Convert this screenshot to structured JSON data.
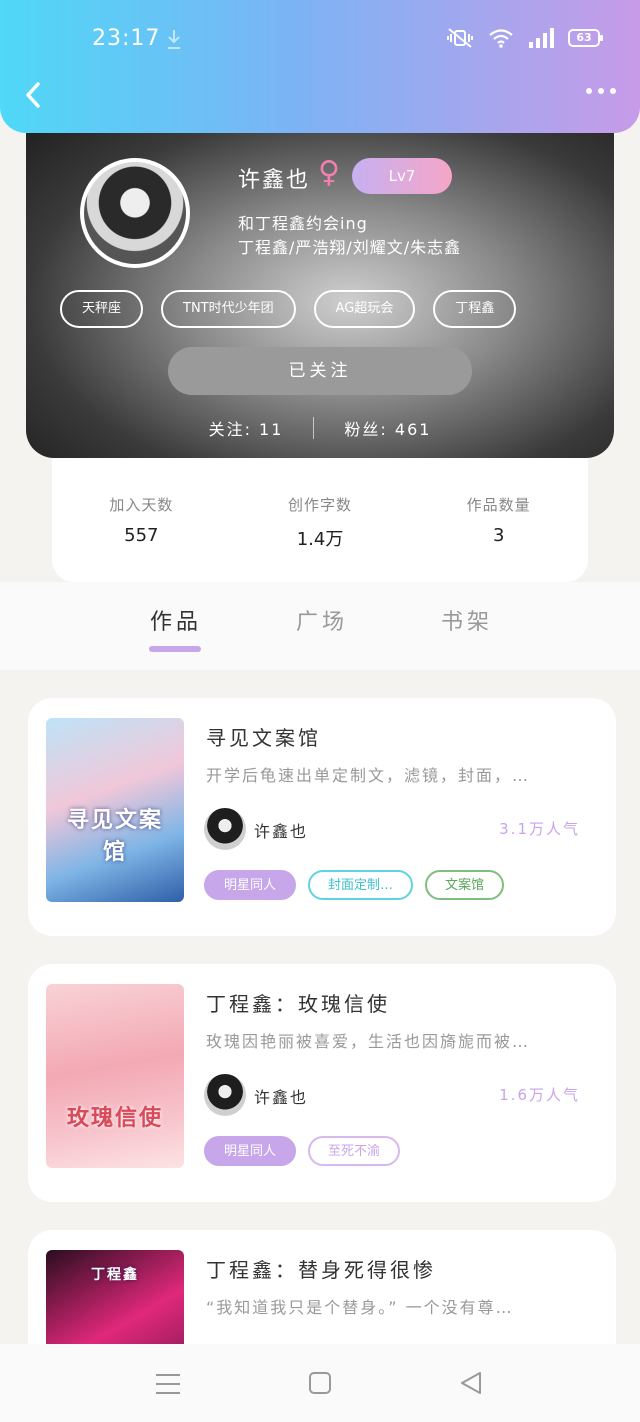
{
  "status_bar": {
    "time": "23:17",
    "battery": "63"
  },
  "profile": {
    "name": "许鑫也",
    "gender_symbol": "♀",
    "level": "Lv7",
    "bio_line1": "和丁程鑫约会ing",
    "bio_line2": "丁程鑫/严浩翔/刘耀文/朱志鑫",
    "tags": [
      "天秤座",
      "TNT时代少年团",
      "AG超玩会",
      "丁程鑫"
    ],
    "follow_label": "已关注",
    "following": "关注: 11",
    "fans": "粉丝: 461"
  },
  "stats": [
    {
      "label": "加入天数",
      "value": "557"
    },
    {
      "label": "创作字数",
      "value": "1.4万"
    },
    {
      "label": "作品数量",
      "value": "3"
    }
  ],
  "tabs": [
    "作品",
    "广场",
    "书架"
  ],
  "works": [
    {
      "title": "寻见文案馆",
      "desc": "开学后龟速出单定制文，滤镜，封面，…",
      "author": "许鑫也",
      "popularity": "3.1万人气",
      "tags": [
        "明星同人",
        "封面定制…",
        "文案馆"
      ],
      "cover_text": "寻见文案馆"
    },
    {
      "title": "丁程鑫：玫瑰信使",
      "desc": "玫瑰因艳丽被喜爱，生活也因旖旎而被…",
      "author": "许鑫也",
      "popularity": "1.6万人气",
      "tags": [
        "明星同人",
        "至死不渝"
      ],
      "cover_text": "玫瑰信使"
    },
    {
      "title": "丁程鑫：替身死得很惨",
      "desc": "“我知道我只是个替身。” 一个没有尊…",
      "cover_text": "丁程鑫"
    }
  ]
}
